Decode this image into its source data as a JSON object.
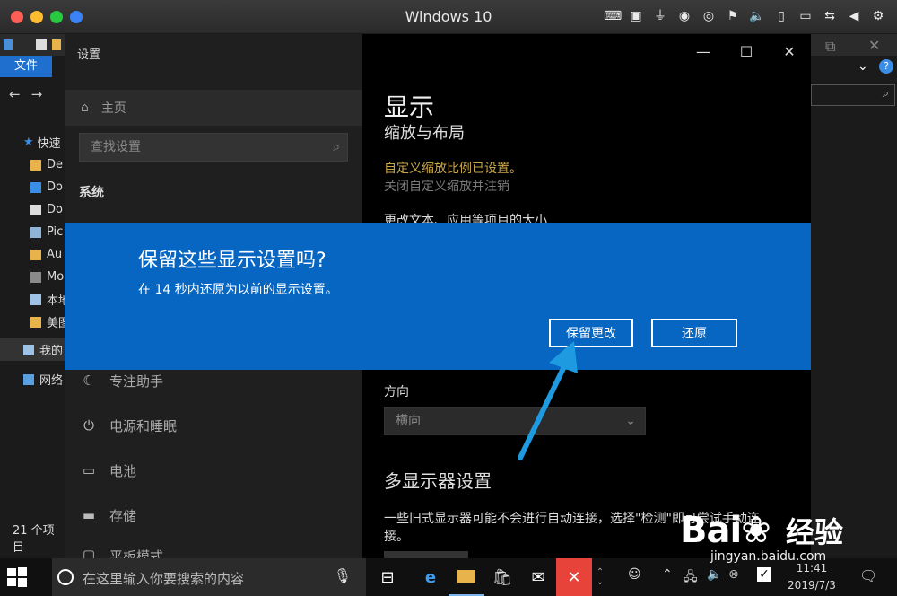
{
  "mac": {
    "title": "Windows 10",
    "colors": {
      "close": "#fd5f57",
      "min": "#febc2e",
      "max": "#28c840",
      "extra": "#3b82f6"
    }
  },
  "explorer": {
    "file_tab": "文件",
    "quick_access": "快速",
    "items": [
      "De",
      "Do",
      "Do",
      "Pic",
      "Au",
      "Mo",
      "本地",
      "美图"
    ],
    "this_pc": "我的",
    "network": "网络",
    "status": "21 个项目"
  },
  "settings": {
    "window_title": "设置",
    "home": "主页",
    "search_placeholder": "查找设置",
    "system_label": "系统",
    "nav": [
      "专注助手",
      "电源和睡眠",
      "电池",
      "存储",
      "平板模式"
    ],
    "heading": "显示",
    "subheading": "缩放与布局",
    "custom_scale_notice": "自定义缩放比例已设置。",
    "disable_custom_scale": "关闭自定义缩放并注销",
    "change_size": "更改文本、应用等项目的大小",
    "orientation_label": "方向",
    "orientation_value": "横向",
    "multi_display_heading": "多显示器设置",
    "multi_display_text": "一些旧式显示器可能不会进行自动连接，选择\"检测\"即可尝试手动连接。"
  },
  "dialog": {
    "title": "保留这些显示设置吗?",
    "message": "在 14 秒内还原为以前的显示设置。",
    "keep_button": "保留更改",
    "revert_button": "还原",
    "bg_color": "#0766c2"
  },
  "taskbar": {
    "search_placeholder": "在这里输入你要搜索的内容",
    "time": "11:41",
    "date": "2019/7/3"
  },
  "watermark": {
    "logo": "Bai",
    "text": "经验",
    "url": "jingyan.baidu.com"
  },
  "annotation": {
    "arrow_color": "#1e9be0"
  }
}
